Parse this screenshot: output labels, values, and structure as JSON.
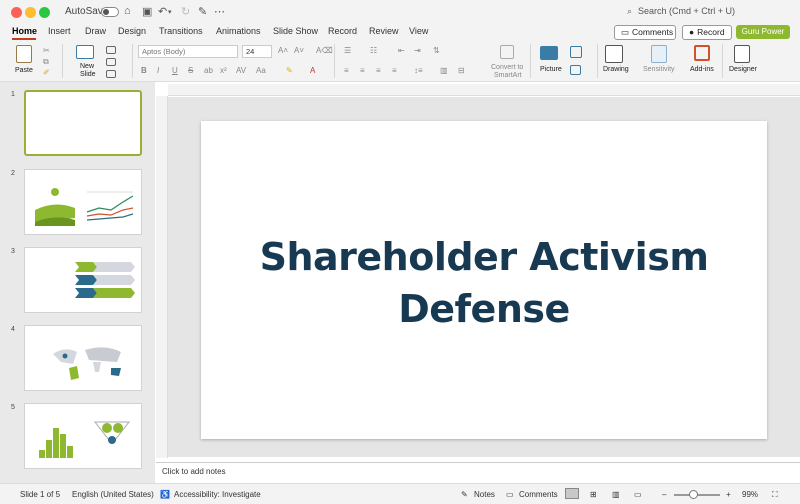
{
  "titlebar": {
    "autosave_label": "AutoSave",
    "search_placeholder": "Search (Cmd + Ctrl + U)"
  },
  "tabs": [
    "Home",
    "Insert",
    "Draw",
    "Design",
    "Transitions",
    "Animations",
    "Slide Show",
    "Record",
    "Review",
    "View"
  ],
  "top_buttons": {
    "comments": "Comments",
    "record": "Record",
    "guru": "Guru Power"
  },
  "ribbon": {
    "paste": "Paste",
    "new_slide_line1": "New",
    "new_slide_line2": "Slide",
    "font_name": "Aptos (Body)",
    "font_size": "24",
    "convert_line1": "Convert to",
    "convert_line2": "SmartArt",
    "picture": "Picture",
    "drawing": "Drawing",
    "sensitivity": "Sensitivity",
    "addins": "Add-ins",
    "designer": "Designer"
  },
  "thumbnails": [
    {
      "num": "1"
    },
    {
      "num": "2"
    },
    {
      "num": "3"
    },
    {
      "num": "4"
    },
    {
      "num": "5"
    }
  ],
  "slide": {
    "title_line1": "Shareholder Activism",
    "title_line2": "Defense"
  },
  "notes_placeholder": "Click to add notes",
  "status": {
    "slide_of": "Slide 1 of 5",
    "language": "English (United States)",
    "accessibility": "Accessibility: Investigate",
    "notes": "Notes",
    "comments": "Comments",
    "zoom": "99%"
  },
  "colors": {
    "accent_green": "#8db830",
    "title_navy": "#173a52",
    "tab_underline": "#c43e1c",
    "thumb_blue": "#2a6a8a"
  }
}
